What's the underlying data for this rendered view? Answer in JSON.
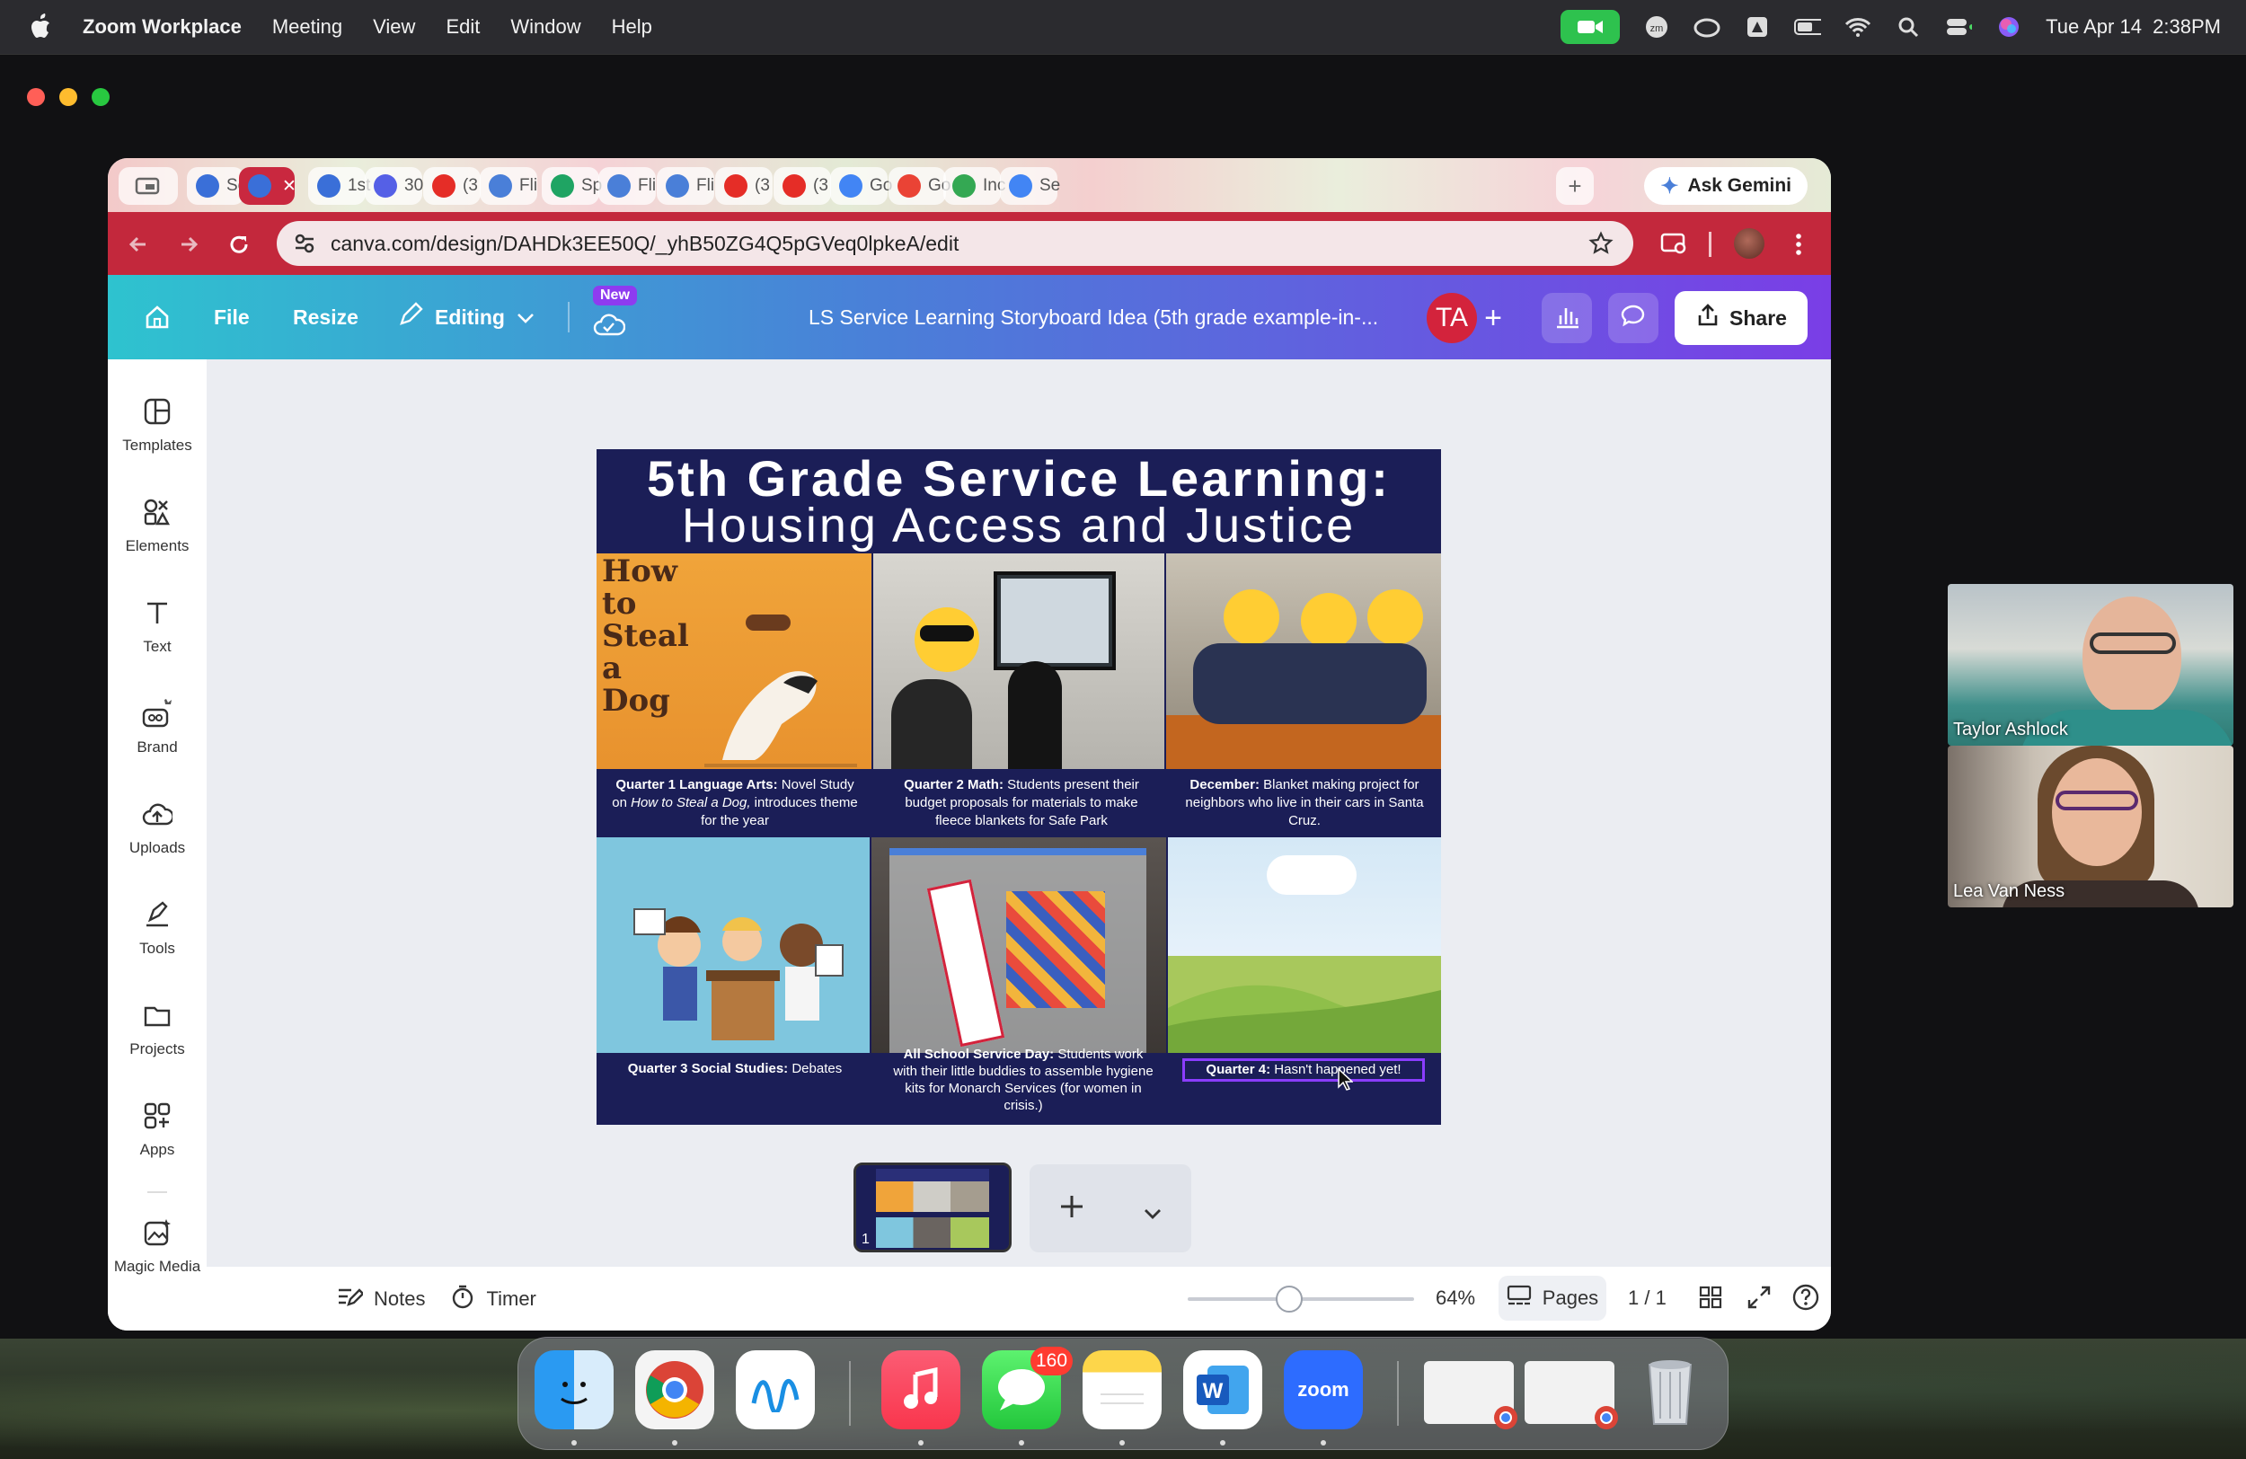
{
  "menubar": {
    "app_name": "Zoom Workplace",
    "items": [
      "Meeting",
      "View",
      "Edit",
      "Window",
      "Help"
    ],
    "clock": "Tue Apr 14  2:38PM"
  },
  "browser": {
    "tabs": [
      {
        "label": "Se",
        "color": "#3a6fd8"
      },
      {
        "label": "",
        "color": "#3a6fd8"
      },
      {
        "label": "1st",
        "color": "#3a6fd8"
      },
      {
        "label": "30",
        "color": "#5560e6"
      },
      {
        "label": "(3",
        "color": "#e52d27"
      },
      {
        "label": "Fli",
        "color": "#4a7fd8"
      },
      {
        "label": "Sp",
        "color": "#1fa463"
      },
      {
        "label": "Fli",
        "color": "#4a7fd8"
      },
      {
        "label": "Fli",
        "color": "#4a7fd8"
      },
      {
        "label": "(3",
        "color": "#e52d27"
      },
      {
        "label": "(3",
        "color": "#e52d27"
      },
      {
        "label": "Go",
        "color": "#4285f4"
      },
      {
        "label": "Go",
        "color": "#ea4335"
      },
      {
        "label": "Inc",
        "color": "#34a853"
      },
      {
        "label": "Se",
        "color": "#4285f4"
      }
    ],
    "ask_gemini": "Ask Gemini",
    "url": "canva.com/design/DAHDk3EE50Q/_yhB50ZG4Q5pGVeq0lpkeA/edit"
  },
  "canva": {
    "file": "File",
    "resize": "Resize",
    "editing": "Editing",
    "new_badge": "New",
    "doc_title": "LS Service Learning Storyboard Idea (5th grade example-in-...",
    "avatar_initials": "TA",
    "share": "Share",
    "sidebar": [
      "Templates",
      "Elements",
      "Text",
      "Brand",
      "Uploads",
      "Tools",
      "Projects",
      "Apps",
      "Magic Media"
    ],
    "notes": "Notes",
    "timer": "Timer",
    "zoom_level": "64%",
    "zoom_fraction": 0.45,
    "pages": "Pages",
    "page_count": "1 / 1",
    "thumb_number": "1"
  },
  "slide": {
    "title_line1": "5th Grade Service Learning:",
    "title_line2": "Housing Access and Justice",
    "book_text": "How to Steal a Dog",
    "cells": [
      {
        "bold": "Quarter 1 Language Arts:",
        "text": " Novel Study on ",
        "italic": "How to Steal a Dog,",
        "text2": " introduces theme for the year"
      },
      {
        "bold": "Quarter 2 Math:",
        "text": " Students present their budget proposals for materials to make fleece blankets for Safe Park"
      },
      {
        "bold": "December:",
        "text": " Blanket making project for neighbors who live in their cars in Santa Cruz."
      },
      {
        "bold": "Quarter 3 Social Studies:",
        "text": " Debates"
      },
      {
        "bold": "All School Service Day:",
        "text": " Students work with their little buddies to assemble hygiene kits for Monarch Services (for women in crisis.)"
      },
      {
        "bold": "Quarter 4:",
        "text": " Hasn't happened yet!"
      }
    ]
  },
  "participants": [
    {
      "name": "Taylor Ashlock"
    },
    {
      "name": "Lea Van Ness"
    }
  ],
  "dock": {
    "messages_badge": "160",
    "zoom_label": "zoom"
  }
}
